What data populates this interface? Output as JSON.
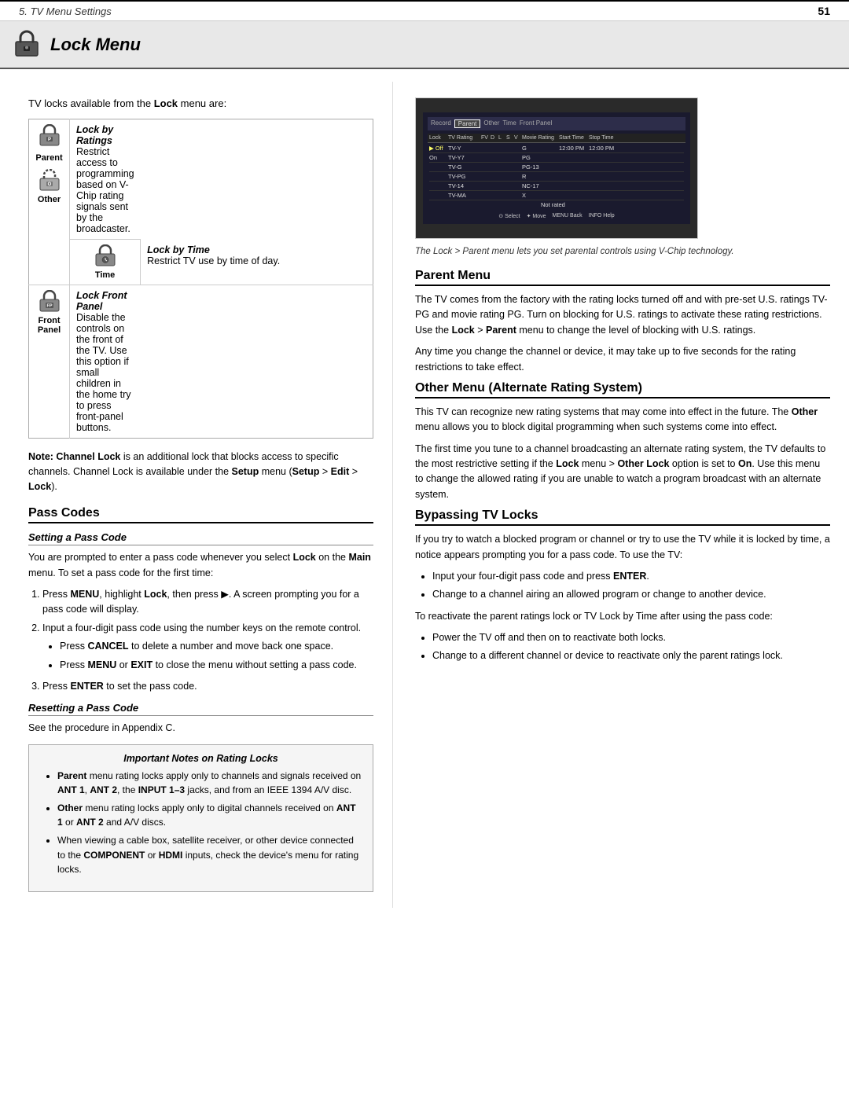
{
  "header": {
    "title": "5.  TV Menu Settings",
    "page_number": "51"
  },
  "lock_menu": {
    "title": "Lock Menu",
    "intro": "TV locks available from the Lock menu are:"
  },
  "lock_types": [
    {
      "icon": "parent-lock",
      "label": "Parent",
      "sub_label": "Other",
      "section_title": "Lock by Ratings",
      "description": "Restrict access to programming based on V-Chip rating signals sent by the broadcaster."
    },
    {
      "icon": "time-lock",
      "label": "Time",
      "section_title": "Lock by Time",
      "description": "Restrict TV use by time of day."
    },
    {
      "icon": "front-panel-lock",
      "label": "Front Panel",
      "section_title": "Lock Front Panel",
      "description": "Disable the controls on the front of the TV.  Use this option if small children in the home try to press front-panel buttons."
    }
  ],
  "note": {
    "label": "Note:",
    "text": "Channel Lock is an additional lock that blocks access to specific channels. Channel Lock is available under the Setup menu (Setup > Edit > Lock)."
  },
  "pass_codes": {
    "section_title": "Pass Codes",
    "setting_title": "Setting a Pass Code",
    "setting_intro": "You are prompted to enter a pass code whenever you select Lock on the Main menu.  To set a pass code for the first time:",
    "steps": [
      "Press MENU, highlight Lock, then press ▶.  A screen prompting you for a pass code will display.",
      "Input a four-digit pass code using the number keys on the remote control.",
      "Press ENTER to set the pass code."
    ],
    "step2_bullets": [
      "Press CANCEL to delete a number and move back one space.",
      "Press MENU or EXIT to close the menu without setting a pass code."
    ],
    "resetting_title": "Resetting a Pass Code",
    "resetting_text": "See the procedure in Appendix C.",
    "important_title": "Important Notes on Rating Locks",
    "important_bullets": [
      "Parent menu rating locks apply only to channels and signals received on ANT 1, ANT 2, the INPUT 1–3 jacks, and from an IEEE 1394 A/V disc.",
      "Other menu rating locks apply only to digital channels received on ANT 1 or ANT 2 and A/V discs.",
      "When viewing a cable box, satellite receiver, or other device connected to the COMPONENT or HDMI inputs, check the device's menu for rating locks."
    ]
  },
  "right_column": {
    "image_caption": "The Lock > Parent menu lets you set parental controls using V-Chip technology.",
    "parent_menu": {
      "title": "Parent Menu",
      "text1": "The TV comes from the factory with the rating locks turned off and with pre-set U.S. ratings TV-PG and movie rating PG.  Turn on blocking for U.S. ratings to activate these rating restrictions.  Use the Lock > Parent menu to change the level of blocking with U.S. ratings.",
      "text2": "Any time you change the channel or device, it may take up to five seconds for the rating restrictions to take effect."
    },
    "other_menu": {
      "title": "Other Menu (Alternate Rating System)",
      "text1": "This TV can recognize new rating systems that may come into effect in the future.  The Other menu allows you to block digital programming when such systems come into effect.",
      "text2": "The first time you tune to a channel broadcasting an alternate rating system, the TV defaults to the most restrictive setting if the Lock menu > Other Lock option is set to On.  Use this menu to change the allowed rating if you are unable to watch a program broadcast with an alternate system."
    },
    "bypassing": {
      "title": "Bypassing TV Locks",
      "text1": "If you try to watch a blocked program or channel or try to use the TV while it is locked by time, a notice appears prompting you for a pass code.  To use the TV:",
      "bullets1": [
        "Input your four-digit pass code and press ENTER.",
        "Change to a channel airing an allowed program or change to another device."
      ],
      "text2": "To reactivate the parent ratings lock or TV Lock by Time after using the pass code:",
      "bullets2": [
        "Power the TV off and then on to reactivate both locks.",
        "Change to a different channel or device to reactivate only the parent ratings lock."
      ]
    }
  },
  "tv_screen": {
    "tabs": [
      "Record",
      "Parent",
      "Other",
      "Time",
      "Front Panel"
    ],
    "headers": [
      "Lock",
      "TV Rating",
      "FV",
      "D",
      "L",
      "S",
      "V",
      "Movie Rating",
      "Start Time",
      "Stop Time"
    ],
    "rows": [
      [
        "Off",
        "TV-Y",
        "",
        "",
        "",
        "",
        "",
        "G",
        "12:00 PM",
        "12:00 PM"
      ],
      [
        "On",
        "TV-Y7",
        "",
        "",
        "",
        "",
        "",
        "PG",
        "",
        ""
      ],
      [
        "",
        "TV-G",
        "",
        "",
        "",
        "",
        "",
        "PG-13",
        "",
        ""
      ],
      [
        "",
        "TV-PG",
        "",
        "",
        "",
        "",
        "",
        "R",
        "",
        ""
      ],
      [
        "",
        "TV-14",
        "",
        "",
        "",
        "",
        "",
        "NC-17",
        "",
        ""
      ],
      [
        "",
        "TV-MA",
        "",
        "",
        "",
        "",
        "",
        "X",
        "",
        ""
      ],
      [
        "",
        "",
        "",
        "",
        "",
        "",
        "",
        "Not rated",
        "",
        ""
      ]
    ],
    "footer": [
      "Select",
      "Move",
      "Back",
      "Help"
    ]
  }
}
